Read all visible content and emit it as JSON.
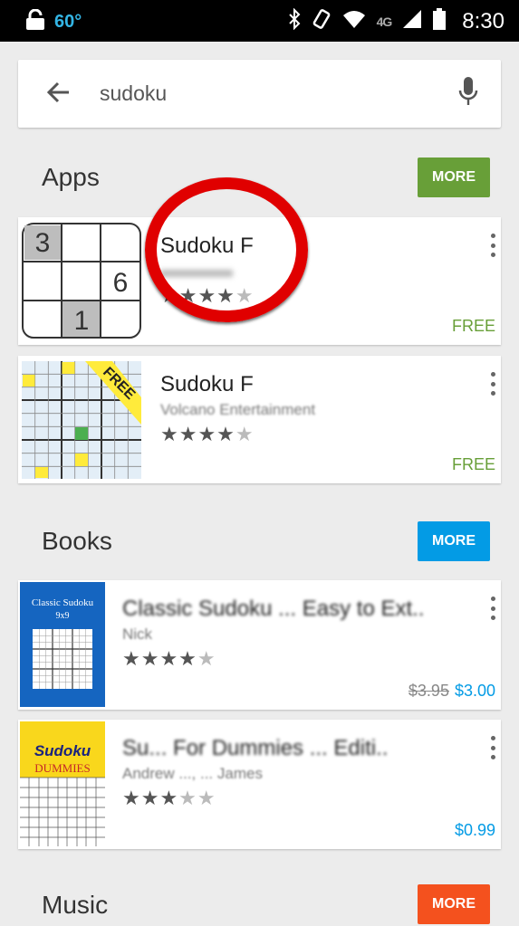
{
  "status_bar": {
    "temperature": "60°",
    "network_label": "4G",
    "time": "8:30"
  },
  "search": {
    "query": "sudoku"
  },
  "sections": {
    "apps": {
      "title": "Apps",
      "more_label": "MORE",
      "more_color": "#689f38"
    },
    "books": {
      "title": "Books",
      "more_label": "MORE",
      "more_color": "#039be5"
    },
    "music": {
      "title": "Music",
      "more_label": "MORE",
      "more_color": "#f4511e"
    }
  },
  "apps": [
    {
      "title": "Sudoku F",
      "rating_stars": 4.5,
      "price": "FREE",
      "icon_grid": [
        "3",
        "",
        "",
        "",
        "",
        "6",
        "",
        "1",
        ""
      ]
    },
    {
      "title": "Sudoku F",
      "developer": "Volcano Entertainment",
      "rating_stars": 4.5,
      "price": "FREE",
      "ribbon": "FREE"
    }
  ],
  "books": [
    {
      "title": "Classic Sudoku ... Easy to Ext..",
      "author": "Nick",
      "rating_stars": 4,
      "old_price": "$3.95",
      "price": "$3.00",
      "cover_title": "Classic Sudoku",
      "cover_subtitle": "9x9"
    },
    {
      "title": "Su... For Dummies ... Editi..",
      "author": "Andrew ..., ... James",
      "rating_stars": 3.5,
      "price": "$0.99",
      "cover_title": "Sudoku",
      "cover_subtitle": "DUMMIES"
    }
  ],
  "colors": {
    "free_green": "#689f38",
    "price_blue": "#039be5",
    "annotation_red": "#e00000"
  }
}
